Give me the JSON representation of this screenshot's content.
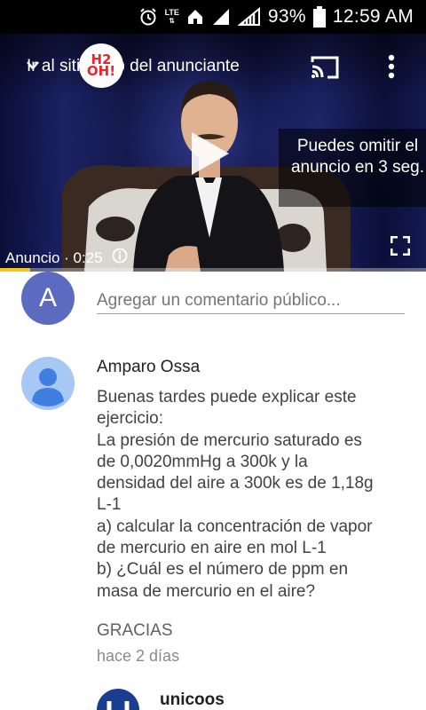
{
  "status_bar": {
    "network": "LTE",
    "battery": "93%",
    "time": "12:59 AM",
    "icons": [
      "alarm-icon",
      "lte-icon",
      "signal-icon",
      "signal-icon",
      "battery-icon"
    ]
  },
  "video": {
    "ad_link": "Ir al sitio web del anunciante",
    "brand_logo_text": "H2 OH!",
    "skip_message": "Puedes omitir el anuncio en 3 seg.",
    "ad_label": "Anuncio · 0:25",
    "progress_fraction": 0.07,
    "icons": [
      "chevron-down-icon",
      "cast-icon",
      "more-vert-icon",
      "play-icon",
      "fullscreen-icon",
      "info-icon"
    ],
    "colors": {
      "progress": "#f5c518"
    }
  },
  "add_comment": {
    "avatar_letter": "A",
    "placeholder": "Agregar un comentario público...",
    "colors": {
      "avatar": "#5c6bc0"
    }
  },
  "comment": {
    "author": "Amparo Ossa",
    "body_lines": [
      "Buenas tardes puede explicar este",
      "ejercicio:",
      "La presión de mercurio saturado es",
      "de 0,0020mmHg a 300k y la",
      "densidad del aire a 300k es de 1,18g",
      "L-1",
      "a) calcular la concentración de vapor",
      "de mercurio en aire en mol L-1",
      "b) ¿Cuál es el número de ppm en",
      "masa de mercurio en el aire?"
    ],
    "thanks": "GRACIAS",
    "time": "hace 2 días"
  },
  "reply": {
    "author": "unicoos"
  }
}
